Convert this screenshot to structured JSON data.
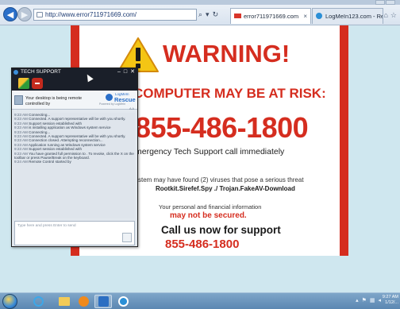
{
  "browser": {
    "url": "http://www.error711971669.com/",
    "active_tab": "error711971669.com",
    "other_tab": "LogMeIn123.com - Remote Su...",
    "tab_close": "×"
  },
  "page": {
    "warning": "WARNING!",
    "risk": "COMPUTER MAY BE AT RISK:",
    "phone_big": "855-486-1800",
    "support_line": "mergency Tech Support call immediately",
    "threat_line1": "ystem may have found (2) viruses that pose a serious threat",
    "threat_line2": "Rootkit.Sirefef.Spy ./ Trojan.FakeAV-Download",
    "personal": "Your personal and financial information",
    "not_secured": "may not be secured.",
    "call_now": "Call us now for support",
    "phone_small": "855-486-1800"
  },
  "tech_support": {
    "title": "TECH SUPPORT",
    "header_message": "Your desktop is being remote controlled by",
    "logo_top": "LogMeIn",
    "logo_bottom": "Rescue",
    "powered_by": "Powered by LogMeIn",
    "input_placeholder": "Type here and press Enter to send",
    "log": [
      {
        "time": "9:23 AM",
        "text": "Connecting..."
      },
      {
        "time": "9:23 AM",
        "text": "Connected. A support representative will be with you shortly."
      },
      {
        "time": "9:23 AM",
        "text": "Support session established with"
      },
      {
        "time": "9:23 AM",
        "text": "is installing application as Windows system service"
      },
      {
        "time": "9:23 AM",
        "text": "Connecting..."
      },
      {
        "time": "9:23 AM",
        "text": "Connected. A support representative will be with you shortly."
      },
      {
        "time": "9:23 AM",
        "text": "Connection closed. Attempting reconnection..."
      },
      {
        "time": "9:23 AM",
        "text": "Application running as Windows system service"
      },
      {
        "time": "9:23 AM",
        "text": "Support session established with"
      },
      {
        "time": "9:23 AM",
        "text": "You have granted full permission to     . To revoke, click the X on the toolbar or press Pause/Break on the keyboard."
      },
      {
        "time": "9:24 AM",
        "text": "Remote Control started by"
      }
    ]
  },
  "taskbar": {
    "clock_time": "9:27 AM",
    "clock_date": "1/12/..."
  }
}
